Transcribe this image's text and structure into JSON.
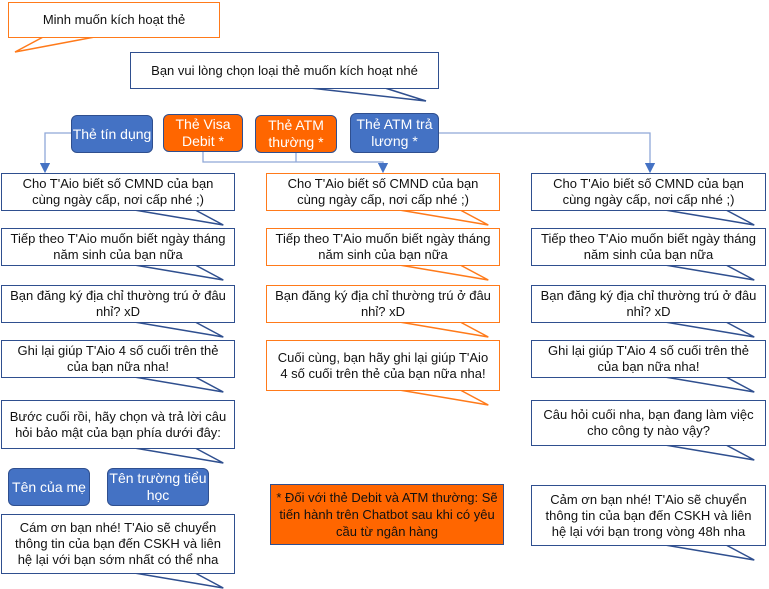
{
  "user_message": "Minh muốn kích hoạt thẻ",
  "bot_prompt": "Bạn vui lòng chọn loại thẻ muốn kích hoạt nhé",
  "card_options": [
    "Thẻ tín dụng",
    "Thẻ Visa Debit *",
    "Thẻ ATM thường *",
    "Thẻ ATM trả lương *"
  ],
  "colors": {
    "blue": "#4472c4",
    "orange": "#ff6600",
    "border": "#2f4f8f"
  },
  "credit_flow": {
    "steps": [
      "Cho T'Aio biết số CMND của bạn cùng ngày cấp, nơi cấp nhé ;)",
      "Tiếp theo T'Aio muốn biết ngày tháng năm sinh của bạn nữa",
      "Bạn đăng ký địa chỉ thường trú ở đâu nhỉ? xD",
      "Ghi lại giúp T'Aio 4 số cuối trên thẻ của bạn nữa nha!",
      "Bước cuối rồi, hãy chọn và trả lời câu hỏi bảo mật của bạn phía dưới đây:"
    ],
    "security_options": [
      "Tên của mẹ",
      "Tên trường tiểu học"
    ],
    "final": "Cám ơn bạn nhé! T'Aio sẽ chuyển thông tin của bạn đến CSKH và liên hệ lại với bạn sớm nhất có thể nha"
  },
  "debit_atm_flow": {
    "steps": [
      "Cho T'Aio biết số CMND của bạn cùng ngày cấp, nơi cấp nhé ;)",
      "Tiếp theo T'Aio muốn biết ngày tháng năm sinh của bạn nữa",
      "Bạn đăng ký địa chỉ thường trú ở đâu nhỉ? xD",
      "Cuối cùng, bạn hãy ghi lại giúp T'Aio 4 số cuối trên thẻ của bạn nữa nha!"
    ]
  },
  "payroll_flow": {
    "steps": [
      "Cho T'Aio biết số CMND của bạn cùng ngày cấp, nơi cấp nhé ;)",
      "Tiếp theo T'Aio muốn biết ngày tháng năm sinh của bạn nữa",
      "Bạn đăng ký địa chỉ thường trú ở đâu nhỉ? xD",
      "Ghi lại giúp T'Aio 4 số cuối trên thẻ của bạn nữa nha!",
      "Câu hỏi cuối nha, bạn đang làm việc cho công ty nào vậy?"
    ],
    "final": "Cảm ơn bạn nhé! T'Aio sẽ chuyển thông tin của bạn đến CSKH và liên hệ lại với bạn trong vòng 48h nha"
  },
  "note": "* Đối với thẻ Debit và ATM thường: Sẽ tiến hành trên Chatbot sau khi có yêu cầu từ ngân hàng"
}
